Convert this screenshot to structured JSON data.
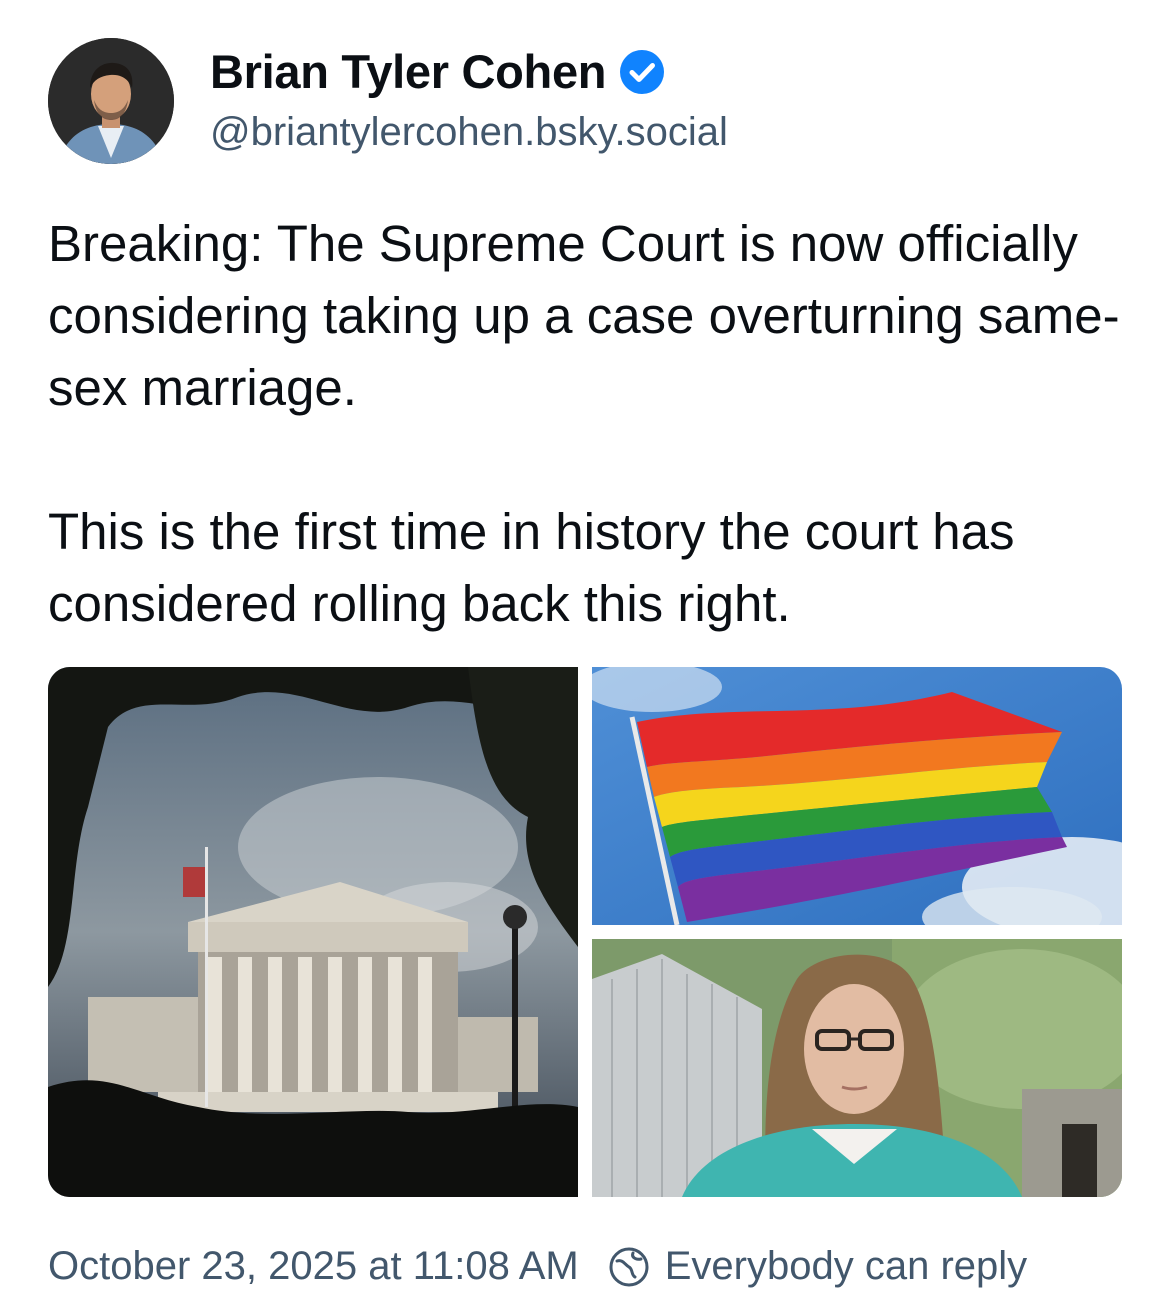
{
  "author": {
    "display_name": "Brian Tyler Cohen",
    "handle": "@briantylercohen.bsky.social",
    "verified": true,
    "avatar": "profile-photo"
  },
  "post": {
    "paragraphs": [
      "Breaking: The Supreme Court is now officially considering taking up a case overturning same-sex marriage.",
      "This is the first time in history the court has considered rolling back this right."
    ],
    "images": [
      {
        "subject": "supreme-court-building"
      },
      {
        "subject": "rainbow-pride-flag"
      },
      {
        "subject": "woman-with-glasses-portrait"
      }
    ]
  },
  "footer": {
    "timestamp": "October 23, 2025 at 11:08 AM",
    "reply_setting": "Everybody can reply",
    "reply_icon": "earth-icon"
  },
  "colors": {
    "text": "#0b0f14",
    "muted": "#42576c",
    "verified": "#1083fe"
  }
}
